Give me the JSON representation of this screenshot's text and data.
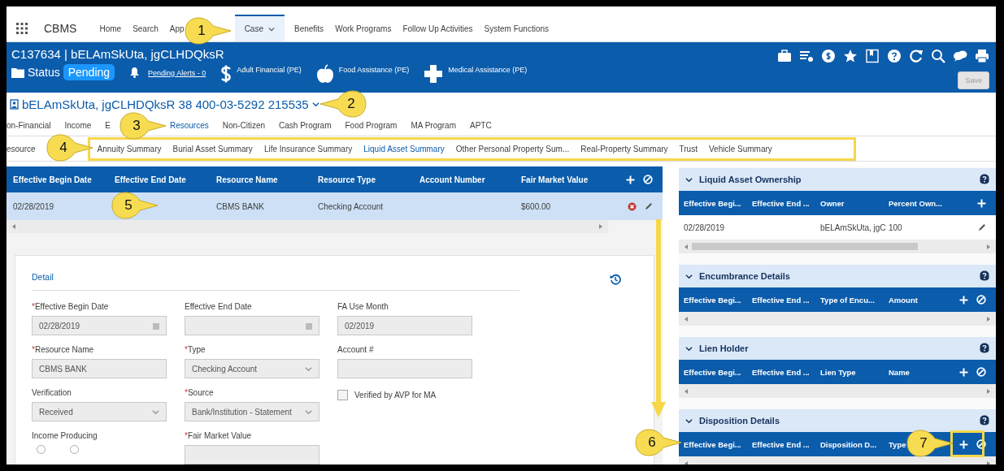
{
  "nav": {
    "app_name": "CBMS",
    "items": [
      {
        "label": "Home",
        "kind": "link",
        "selected": false
      },
      {
        "label": "Search",
        "kind": "link",
        "selected": false
      },
      {
        "label": "App",
        "kind": "link",
        "selected": false
      },
      {
        "label": "Case",
        "kind": "menu",
        "selected": true
      },
      {
        "label": "Benefits",
        "kind": "link",
        "selected": false
      },
      {
        "label": "Work Programs",
        "kind": "link",
        "selected": false
      },
      {
        "label": "Follow Up Activities",
        "kind": "link",
        "selected": false
      },
      {
        "label": "System Functions",
        "kind": "link",
        "selected": false
      }
    ]
  },
  "header": {
    "case_title": "C137634 | bELAmSkUta, jgCLHDQksR",
    "status_label": "Status",
    "status_value": "Pending",
    "alerts_link": "Pending Alerts - 0",
    "programs": [
      {
        "label": "Adult Financial (PE)",
        "kind": "dollar"
      },
      {
        "label": "Food Assistance (PE)",
        "kind": "apple"
      },
      {
        "label": "Medical Assistance (PE)",
        "kind": "cross"
      }
    ],
    "save_button": {
      "label": "Save",
      "disabled": true
    }
  },
  "person": {
    "label": "bELAmSkUta, jgCLHDQksR 38 400-03-5292 215535"
  },
  "tabs": [
    {
      "label": "on-Financial",
      "selected": false
    },
    {
      "label": "Income",
      "selected": false
    },
    {
      "label": "E",
      "selected": false
    },
    {
      "label": "Resources",
      "selected": true
    },
    {
      "label": "Non-Citizen",
      "selected": false
    },
    {
      "label": "Cash Program",
      "selected": false
    },
    {
      "label": "Food Program",
      "selected": false
    },
    {
      "label": "MA Program",
      "selected": false
    },
    {
      "label": "APTC",
      "selected": false
    }
  ],
  "subtabs": [
    {
      "label": "esource",
      "selected": false
    },
    {
      "label": "Annuity Summary",
      "selected": false
    },
    {
      "label": "Burial Asset Summary",
      "selected": false
    },
    {
      "label": "Life Insurance Summary",
      "selected": false
    },
    {
      "label": "Liquid Asset Summary",
      "selected": true
    },
    {
      "label": "Other Personal Property Sum...",
      "selected": false
    },
    {
      "label": "Real-Property Summary",
      "selected": false
    },
    {
      "label": "Trust",
      "selected": false
    },
    {
      "label": "Vehicle Summary",
      "selected": false
    }
  ],
  "resource_table": {
    "columns": [
      "Effective Begin Date",
      "Effective End Date",
      "Resource Name",
      "Resource Type",
      "Account Number",
      "Fair Market Value"
    ],
    "rows": [
      {
        "cells": [
          "02/28/2019",
          "",
          "CBMS BANK",
          "Checking Account",
          "",
          "$600.00"
        ],
        "selected": true
      }
    ]
  },
  "detail": {
    "title": "Detail",
    "rows": [
      [
        {
          "label": "Effective Begin Date",
          "required_mark": "*",
          "kind": "date",
          "value": "02/28/2019"
        },
        {
          "label": "Effective End Date",
          "kind": "date"
        },
        {
          "label": "FA Use Month",
          "kind": "text",
          "value": "02/2019"
        }
      ],
      [
        {
          "label": "Resource Name",
          "required_mark": "*",
          "kind": "text",
          "value": "CBMS BANK"
        },
        {
          "label": "Type",
          "required_mark": "*",
          "kind": "select",
          "value": "Checking Account"
        },
        {
          "label": "Account #",
          "kind": "text"
        }
      ],
      [
        {
          "label": "Verification",
          "kind": "select",
          "value": "Received"
        },
        {
          "label": "Source",
          "required_mark": "*",
          "kind": "select",
          "value": "Bank/Institution - Statement"
        },
        {
          "label": "Verified by AVP for MA",
          "kind": "checkbox",
          "checked": false
        }
      ],
      [
        {
          "label": "Income Producing",
          "kind": "radio",
          "options": [
            {
              "selected": false
            },
            {
              "selected": false
            }
          ]
        },
        {
          "label": "Fair Market Value",
          "required_mark": "*",
          "kind": "text"
        }
      ]
    ]
  },
  "sections": [
    {
      "title": "Liquid Asset Ownership",
      "expanded": true,
      "columns": [
        "Effective Begi...",
        "Effective End ...",
        "Owner",
        "Percent Own..."
      ],
      "actions": [
        {
          "kind": "add"
        }
      ],
      "rows": [
        {
          "cells": [
            "02/28/2019",
            "",
            "bELAmSkUta, jgC",
            "100"
          ]
        }
      ]
    },
    {
      "title": "Encumbrance Details",
      "expanded": true,
      "columns": [
        "Effective Begi...",
        "Effective End ...",
        "Type of Encu...",
        "Amount"
      ],
      "actions": [
        {
          "kind": "add"
        },
        {
          "kind": "block"
        }
      ]
    },
    {
      "title": "Lien Holder",
      "expanded": true,
      "columns": [
        "Effective Begi...",
        "Effective End ...",
        "Lien Type",
        "Name"
      ],
      "actions": [
        {
          "kind": "add"
        },
        {
          "kind": "block"
        }
      ]
    },
    {
      "title": "Disposition Details",
      "expanded": true,
      "columns": [
        "Effective Begi...",
        "Effective End ...",
        "Disposition D...",
        "Type"
      ],
      "actions": [
        {
          "kind": "add"
        },
        {
          "kind": "block"
        }
      ]
    }
  ],
  "callouts": [
    {
      "number": "1"
    },
    {
      "number": "2"
    },
    {
      "number": "3"
    },
    {
      "number": "4"
    },
    {
      "number": "5"
    },
    {
      "number": "6"
    },
    {
      "number": "7"
    }
  ]
}
